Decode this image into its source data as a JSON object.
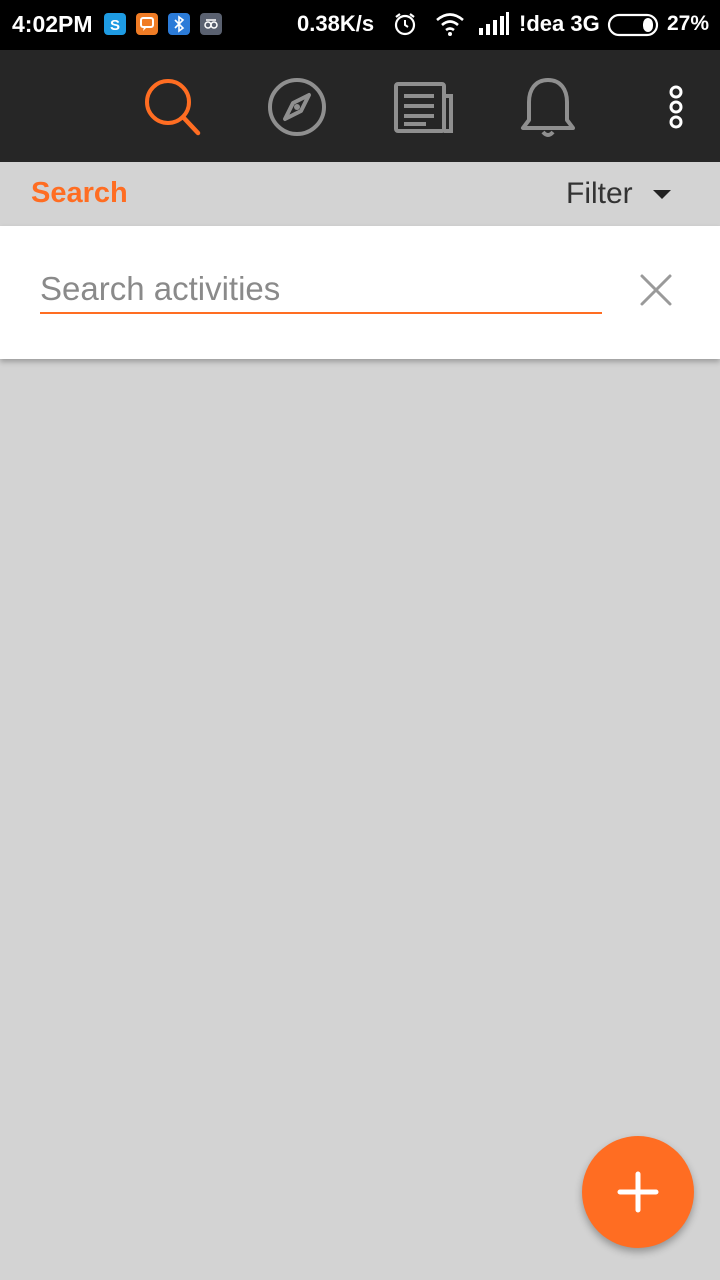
{
  "status_bar": {
    "time": "4:02PM",
    "network_speed": "0.38K/s",
    "carrier": "!dea 3G",
    "battery": "27%",
    "icons": [
      "skype-icon",
      "chat-icon",
      "bluetooth-icon",
      "app-icon",
      "alarm-icon",
      "wifi-icon",
      "signal-icon",
      "battery-icon"
    ]
  },
  "nav": {
    "items": [
      {
        "name": "search",
        "icon": "search-icon",
        "active": true
      },
      {
        "name": "explore",
        "icon": "compass-icon",
        "active": false
      },
      {
        "name": "news",
        "icon": "newspaper-icon",
        "active": false
      },
      {
        "name": "notifications",
        "icon": "bell-icon",
        "active": false
      },
      {
        "name": "more",
        "icon": "more-vertical-icon",
        "active": false
      }
    ]
  },
  "sub_header": {
    "title": "Search",
    "filter_label": "Filter"
  },
  "search": {
    "placeholder": "Search activities",
    "value": ""
  },
  "colors": {
    "accent": "#ff6d22",
    "toolbar": "#262626",
    "background": "#d3d3d3"
  }
}
